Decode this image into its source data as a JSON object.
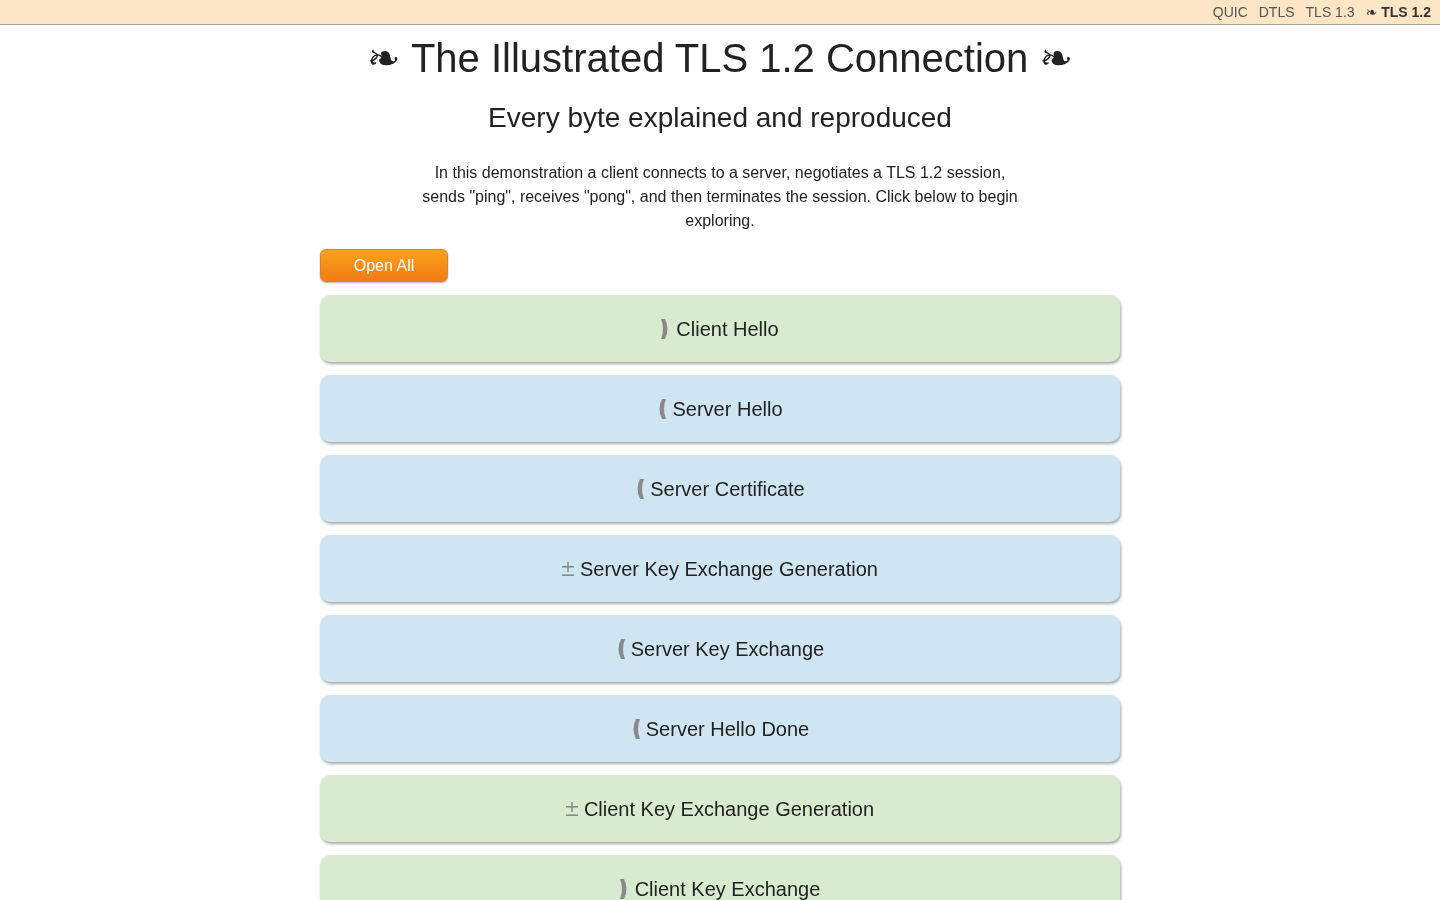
{
  "nav": {
    "links": [
      {
        "label": "QUIC",
        "selected": false
      },
      {
        "label": "DTLS",
        "selected": false
      },
      {
        "label": "TLS 1.3",
        "selected": false
      },
      {
        "label": "❧ TLS 1.2",
        "selected": true
      }
    ]
  },
  "title": "❧ The Illustrated TLS 1.2 Connection ❧",
  "subtitle": "Every byte explained and reproduced",
  "intro": "In this demonstration a client connects to a server, negotiates a TLS 1.2 session, sends \"ping\", receives \"pong\", and then terminates the session. Click below to begin exploring.",
  "open_all_button": "Open All",
  "records": [
    {
      "label": "Client Hello",
      "color": "#d8ebcf",
      "kind": "send"
    },
    {
      "label": "Server Hello",
      "color": "#cfe5f2",
      "kind": "receive"
    },
    {
      "label": "Server Certificate",
      "color": "#cfe5f2",
      "kind": "receive"
    },
    {
      "label": "Server Key Exchange Generation",
      "color": "#cfe5f2",
      "kind": "compute"
    },
    {
      "label": "Server Key Exchange",
      "color": "#cfe5f2",
      "kind": "receive"
    },
    {
      "label": "Server Hello Done",
      "color": "#cfe5f2",
      "kind": "receive"
    },
    {
      "label": "Client Key Exchange Generation",
      "color": "#d8ebcf",
      "kind": "compute"
    },
    {
      "label": "Client Key Exchange",
      "color": "#d8ebcf",
      "kind": "send"
    }
  ]
}
